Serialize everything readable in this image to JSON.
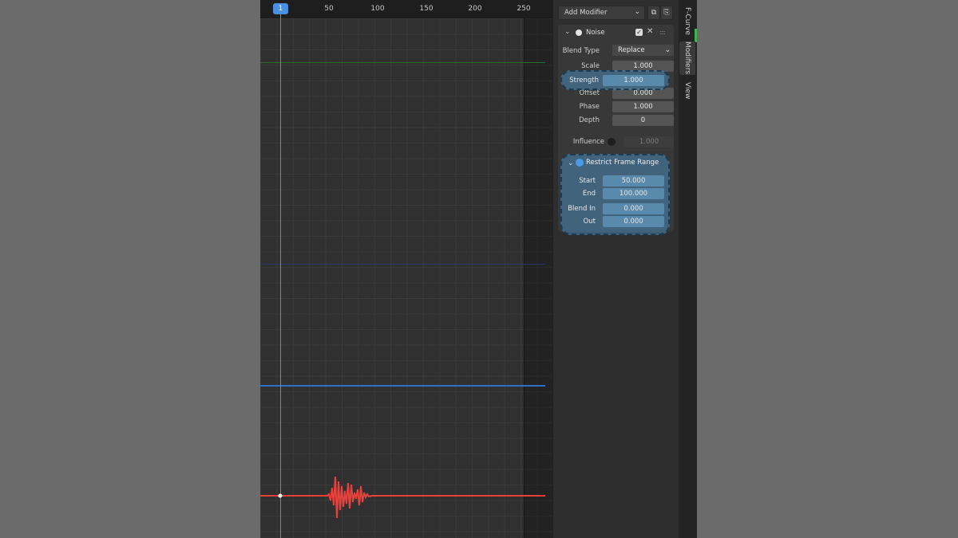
{
  "ruler": {
    "current_frame": "1",
    "ticks": [
      "50",
      "100",
      "150",
      "200",
      "250"
    ]
  },
  "sidebar": {
    "add_modifier_label": "Add Modifier",
    "modifier": {
      "name": "Noise",
      "blend_type_label": "Blend Type",
      "blend_type_value": "Replace",
      "scale_label": "Scale",
      "scale_value": "1.000",
      "strength_label": "Strength",
      "strength_value": "1.000",
      "offset_label": "Offset",
      "offset_value": "0.000",
      "phase_label": "Phase",
      "phase_value": "1.000",
      "depth_label": "Depth",
      "depth_value": "0",
      "influence_label": "Influence",
      "influence_value": "1.000",
      "restrict": {
        "title": "Restrict Frame Range",
        "start_label": "Start",
        "start_value": "50.000",
        "end_label": "End",
        "end_value": "100.000",
        "blend_in_label": "Blend In",
        "blend_in_value": "0.000",
        "out_label": "Out",
        "out_value": "0.000"
      }
    }
  },
  "tabs": [
    "F-Curve",
    "Modifiers",
    "View"
  ],
  "colors": {
    "playhead": "#4a8fe0",
    "curve": "#e8413c",
    "x_channel": "#2f6b2f",
    "y_channel": "#2d3566",
    "z_channel": "#2f6fc4",
    "highlight": "#4a86b4"
  }
}
